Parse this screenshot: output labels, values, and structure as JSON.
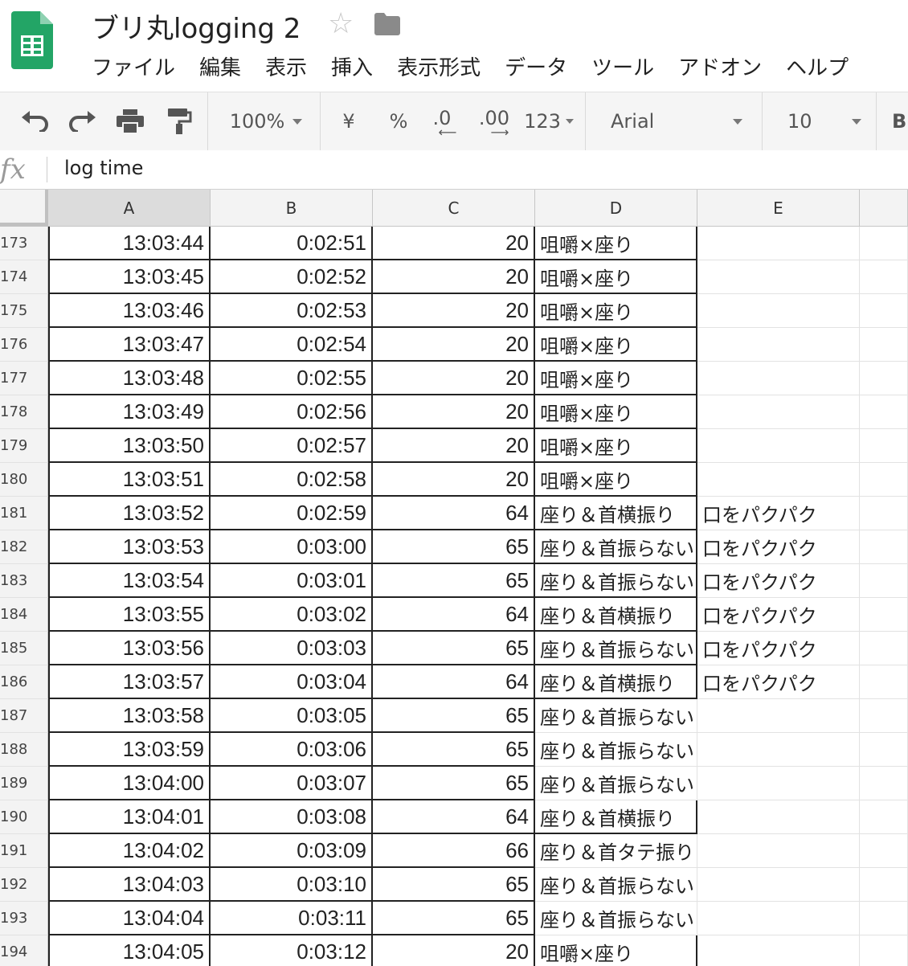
{
  "app": {
    "title": "ブリ丸logging 2",
    "icon": "sheets-logo-icon",
    "menu": [
      "ファイル",
      "編集",
      "表示",
      "挿入",
      "表示形式",
      "データ",
      "ツール",
      "アドオン",
      "ヘルプ"
    ]
  },
  "toolbar": {
    "zoom": "100%",
    "currency": "¥",
    "percent": "%",
    "decrease_decimal": ".0",
    "increase_decimal": ".00",
    "more_formats": "123",
    "font": "Arial",
    "font_size": "10",
    "bold": "B"
  },
  "formula_bar": {
    "fx": "fx",
    "value": "log time"
  },
  "columns": [
    "A",
    "B",
    "C",
    "D",
    "E"
  ],
  "rows": [
    {
      "n": "173",
      "a": "13:03:44",
      "b": "0:02:51",
      "c": "20",
      "d": "咀嚼×座り",
      "e": ""
    },
    {
      "n": "174",
      "a": "13:03:45",
      "b": "0:02:52",
      "c": "20",
      "d": "咀嚼×座り",
      "e": ""
    },
    {
      "n": "175",
      "a": "13:03:46",
      "b": "0:02:53",
      "c": "20",
      "d": "咀嚼×座り",
      "e": ""
    },
    {
      "n": "176",
      "a": "13:03:47",
      "b": "0:02:54",
      "c": "20",
      "d": "咀嚼×座り",
      "e": ""
    },
    {
      "n": "177",
      "a": "13:03:48",
      "b": "0:02:55",
      "c": "20",
      "d": "咀嚼×座り",
      "e": ""
    },
    {
      "n": "178",
      "a": "13:03:49",
      "b": "0:02:56",
      "c": "20",
      "d": "咀嚼×座り",
      "e": ""
    },
    {
      "n": "179",
      "a": "13:03:50",
      "b": "0:02:57",
      "c": "20",
      "d": "咀嚼×座り",
      "e": ""
    },
    {
      "n": "180",
      "a": "13:03:51",
      "b": "0:02:58",
      "c": "20",
      "d": "咀嚼×座り",
      "e": ""
    },
    {
      "n": "181",
      "a": "13:03:52",
      "b": "0:02:59",
      "c": "64",
      "d": "座り＆首横振り",
      "e": "口をパクパク"
    },
    {
      "n": "182",
      "a": "13:03:53",
      "b": "0:03:00",
      "c": "65",
      "d": "座り＆首振らない",
      "e": "口をパクパク"
    },
    {
      "n": "183",
      "a": "13:03:54",
      "b": "0:03:01",
      "c": "65",
      "d": "座り＆首振らない",
      "e": "口をパクパク"
    },
    {
      "n": "184",
      "a": "13:03:55",
      "b": "0:03:02",
      "c": "64",
      "d": "座り＆首横振り",
      "e": "口をパクパク"
    },
    {
      "n": "185",
      "a": "13:03:56",
      "b": "0:03:03",
      "c": "65",
      "d": "座り＆首振らない",
      "e": "口をパクパク"
    },
    {
      "n": "186",
      "a": "13:03:57",
      "b": "0:03:04",
      "c": "64",
      "d": "座り＆首横振り",
      "e": "口をパクパク"
    },
    {
      "n": "187",
      "a": "13:03:58",
      "b": "0:03:05",
      "c": "65",
      "d": "座り＆首振らない",
      "e": ""
    },
    {
      "n": "188",
      "a": "13:03:59",
      "b": "0:03:06",
      "c": "65",
      "d": "座り＆首振らない",
      "e": ""
    },
    {
      "n": "189",
      "a": "13:04:00",
      "b": "0:03:07",
      "c": "65",
      "d": "座り＆首振らない",
      "e": ""
    },
    {
      "n": "190",
      "a": "13:04:01",
      "b": "0:03:08",
      "c": "64",
      "d": "座り＆首横振り",
      "e": ""
    },
    {
      "n": "191",
      "a": "13:04:02",
      "b": "0:03:09",
      "c": "66",
      "d": "座り＆首タテ振り",
      "e": ""
    },
    {
      "n": "192",
      "a": "13:04:03",
      "b": "0:03:10",
      "c": "65",
      "d": "座り＆首振らない",
      "e": ""
    },
    {
      "n": "193",
      "a": "13:04:04",
      "b": "0:03:11",
      "c": "65",
      "d": "座り＆首振らない",
      "e": ""
    },
    {
      "n": "194",
      "a": "13:04:05",
      "b": "0:03:12",
      "c": "20",
      "d": "咀嚼×座り",
      "e": ""
    }
  ]
}
